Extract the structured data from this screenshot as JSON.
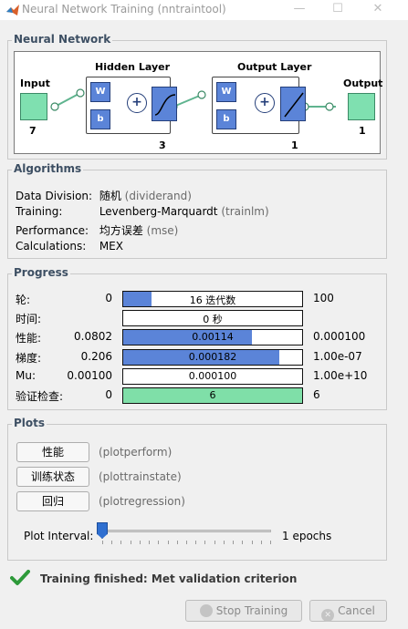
{
  "window": {
    "title": "Neural Network Training (nntraintool)",
    "minimize": "—",
    "maximize": "☐",
    "close": "✕"
  },
  "network": {
    "title": "Neural Network",
    "input_label": "Input",
    "input_size": "7",
    "hidden_label": "Hidden Layer",
    "hidden_size": "3",
    "output_layer_label": "Output Layer",
    "output_layer_size": "1",
    "output_label": "Output",
    "output_size": "1",
    "weight_symbol": "W",
    "bias_symbol": "b",
    "sum_symbol": "+"
  },
  "algorithms": {
    "title": "Algorithms",
    "rows": [
      {
        "key": "Data Division:",
        "value": "随机",
        "fn": "(dividerand)"
      },
      {
        "key": "Training:",
        "value": "Levenberg-Marquardt",
        "fn": "(trainlm)"
      },
      {
        "key": "Performance:",
        "value": "均方误差",
        "fn": "(mse)"
      },
      {
        "key": "Calculations:",
        "value": "MEX",
        "fn": ""
      }
    ]
  },
  "progress": {
    "title": "Progress",
    "rows": [
      {
        "name": "轮:",
        "start": "0",
        "current": "16 迭代数",
        "end": "100",
        "fraction": 0.16,
        "color": "#5b84d8"
      },
      {
        "name": "时间:",
        "start": "",
        "current": "0 秒",
        "end": "",
        "fraction": 0,
        "color": "#5b84d8"
      },
      {
        "name": "性能:",
        "start": "0.0802",
        "current": "0.00114",
        "end": "0.000100",
        "fraction": 0.72,
        "color": "#5b84d8"
      },
      {
        "name": "梯度:",
        "start": "0.206",
        "current": "0.000182",
        "end": "1.00e-07",
        "fraction": 0.87,
        "color": "#5b84d8"
      },
      {
        "name": "Mu:",
        "start": "0.00100",
        "current": "0.000100",
        "end": "1.00e+10",
        "fraction": 0,
        "color": "#5b84d8"
      },
      {
        "name": "验证检查:",
        "start": "0",
        "current": "6",
        "end": "6",
        "fraction": 1.0,
        "color": "#7fdfa8"
      }
    ]
  },
  "plots": {
    "title": "Plots",
    "buttons": [
      {
        "label": "性能",
        "fn": "(plotperform)"
      },
      {
        "label": "训练状态",
        "fn": "(plottrainstate)"
      },
      {
        "label": "回归",
        "fn": "(plotregression)"
      }
    ],
    "interval_label": "Plot Interval:",
    "interval_value": "1 epochs",
    "interval_fraction": 0.0
  },
  "status": {
    "text": "Training finished: Met validation criterion",
    "color": "#2e9a3a"
  },
  "footer": {
    "stop_label": "Stop Training",
    "cancel_label": "Cancel"
  }
}
